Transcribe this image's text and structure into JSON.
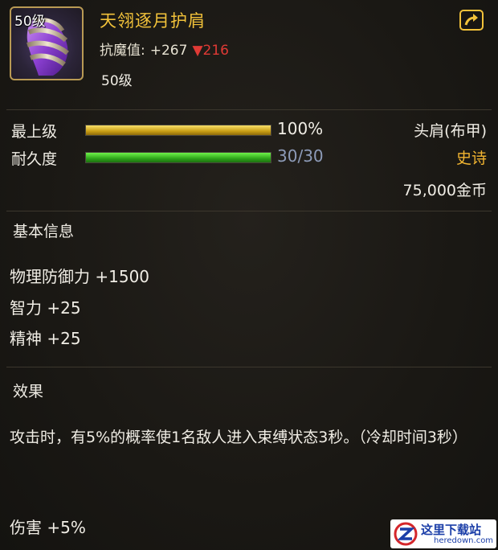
{
  "item": {
    "level_badge": "50级",
    "name": "天翎逐月护肩",
    "stat_label": "抗魔值:",
    "stat_plus": "+267",
    "stat_down": "▼216",
    "required_level": "50级",
    "icon": "purple-shoulder-armor-icon"
  },
  "bars": [
    {
      "label": "最上级",
      "value_text": "100%",
      "fill": 1.0,
      "color": "#f7d84a",
      "value_color": "#f0ede5"
    },
    {
      "label": "耐久度",
      "value_text": "30/30",
      "fill": 1.0,
      "color": "#4fdc2a",
      "value_color": "#8d9bb8"
    }
  ],
  "info": {
    "slot": "头肩(布甲)",
    "rarity": "史诗",
    "rarity_color": "#f2b531",
    "price": "75,000金币"
  },
  "basic": {
    "title": "基本信息",
    "attrs": [
      "物理防御力 +1500",
      "智力 +25",
      "精神 +25"
    ]
  },
  "effect": {
    "title": "效果",
    "text": "攻击时，有5%的概率使1名敌人进入束缚状态3秒。（冷却时间3秒）",
    "damage": "伤害 +5%"
  },
  "watermark": {
    "cn": "这里下载站",
    "en": "heredown.com"
  }
}
